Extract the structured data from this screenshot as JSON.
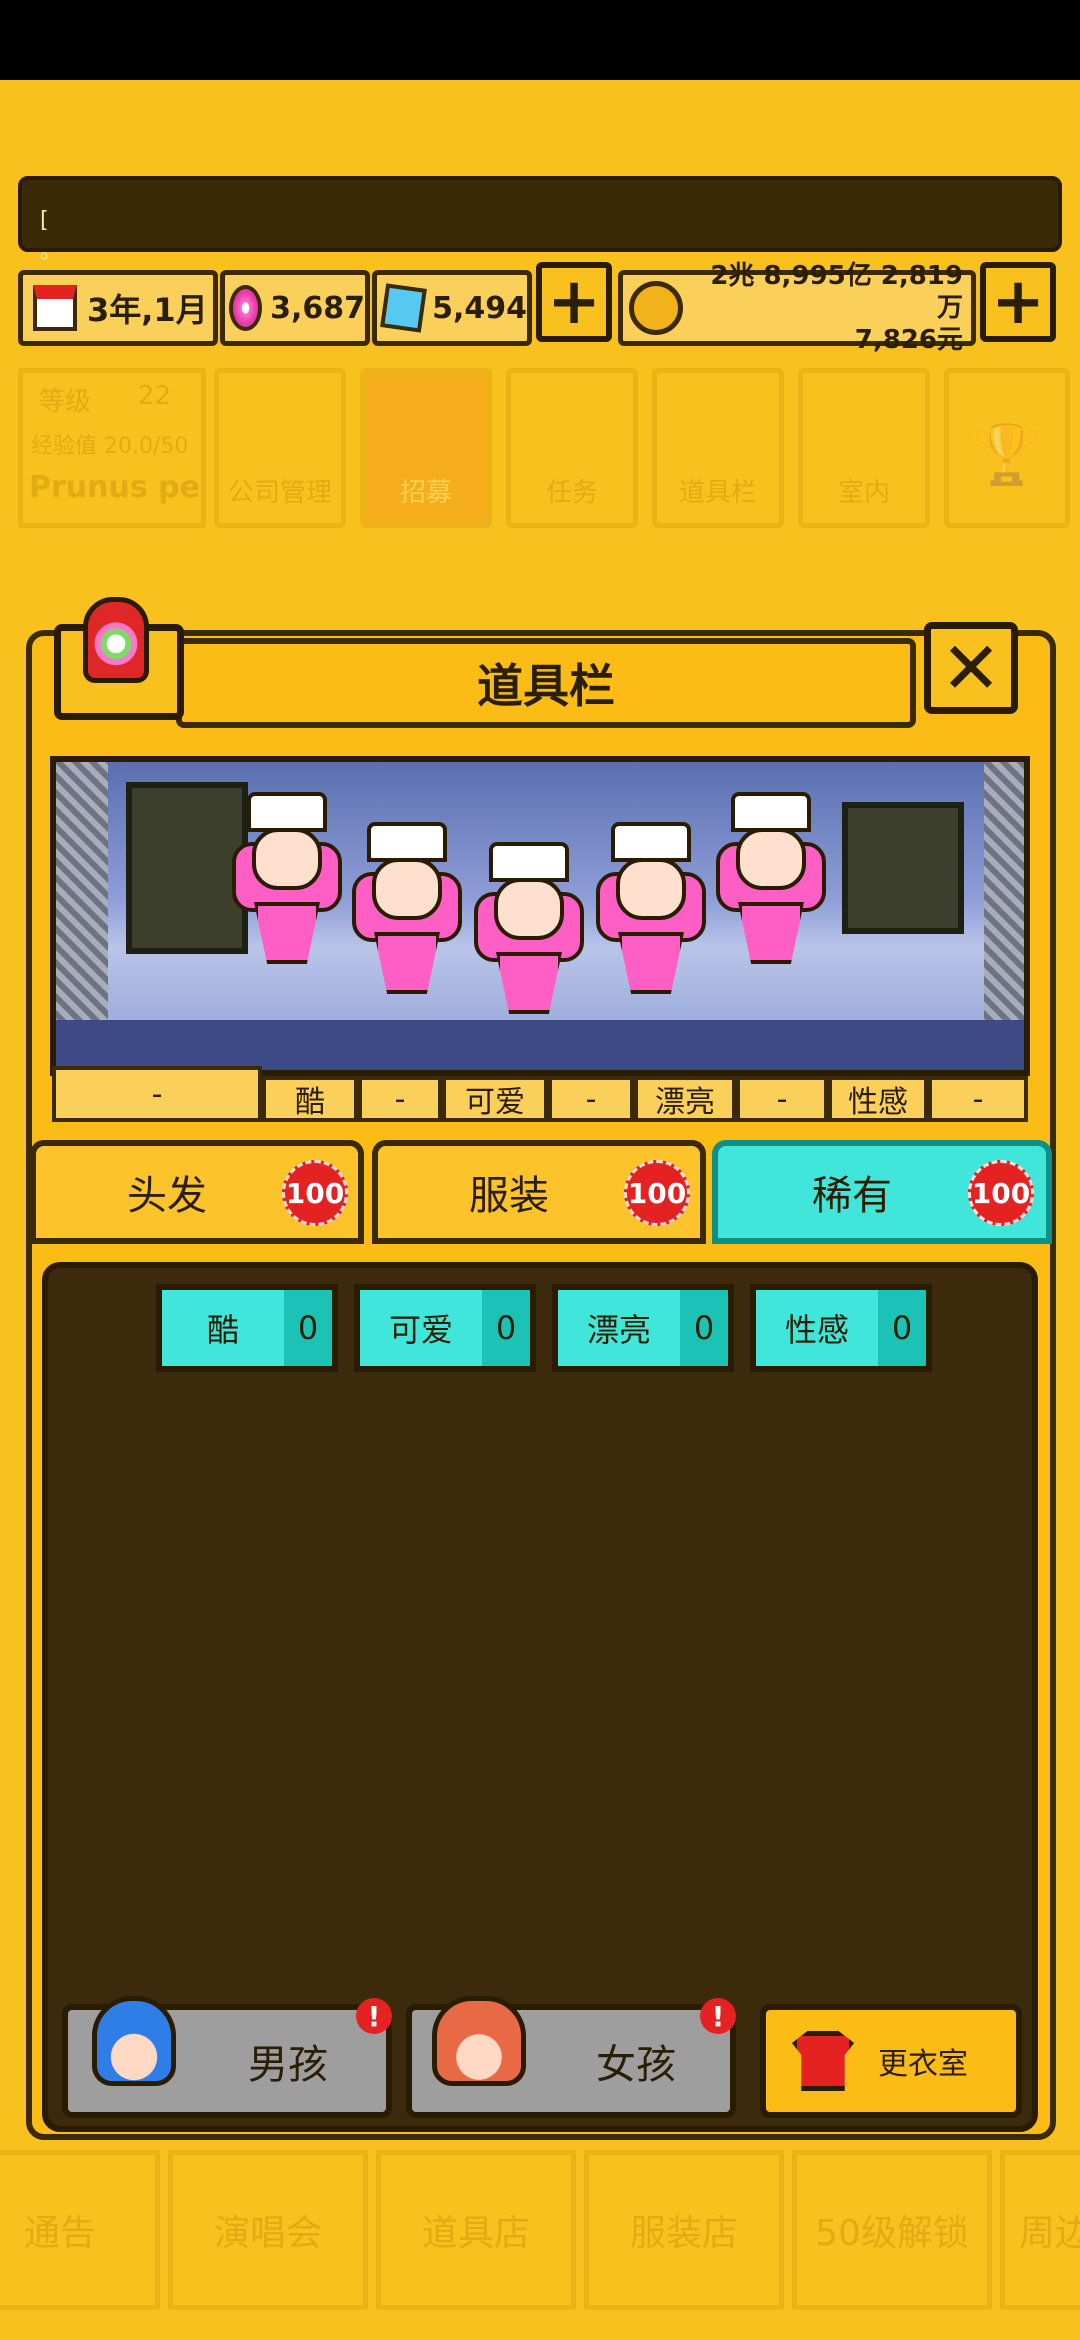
{
  "ticker": {
    "text": "[\n。"
  },
  "stats": {
    "date": "3年,1月",
    "pink_gems": "3,687",
    "blue_gems": "5,494",
    "money_line1": "2兆 8,995亿 2,819万",
    "money_line2": "7,826元"
  },
  "nav_bg": {
    "level_label": "等级",
    "level_value": "22",
    "exp_label": "经验值 20.0/50",
    "company_name": "Prunus persi",
    "items": [
      "公司管理",
      "招募",
      "任务",
      "道具栏",
      "室内"
    ]
  },
  "bottom_bg": {
    "items": [
      "通告",
      "演唱会",
      "道具店",
      "服装店",
      "50级解锁",
      "周边"
    ]
  },
  "dialog": {
    "title": "道具栏",
    "labels": [
      "-",
      "酷",
      "-",
      "可爱",
      "-",
      "漂亮",
      "-",
      "性感",
      "-"
    ],
    "tabs": [
      {
        "label": "头发",
        "badge": "100"
      },
      {
        "label": "服装",
        "badge": "100"
      },
      {
        "label": "稀有",
        "badge": "100"
      }
    ],
    "filters": [
      {
        "label": "酷",
        "count": "0"
      },
      {
        "label": "可爱",
        "count": "0"
      },
      {
        "label": "漂亮",
        "count": "0"
      },
      {
        "label": "性感",
        "count": "0"
      }
    ],
    "boy_button": "男孩",
    "girl_button": "女孩",
    "wardrobe_button": "更衣室",
    "alert": "!",
    "close": "✕"
  },
  "colors": {
    "background": "#f9c11e",
    "panel": "#fbbd15",
    "accent_teal": "#40e6da",
    "badge_red": "#e52222",
    "dark": "#3b2a0c"
  },
  "icons": [
    "calendar-icon",
    "pink-gem-icon",
    "blue-gem-icon",
    "coin-icon",
    "plus-icon",
    "close-icon",
    "gacha-bag-icon",
    "boy-face-icon",
    "girl-face-icon",
    "shirt-icon"
  ]
}
